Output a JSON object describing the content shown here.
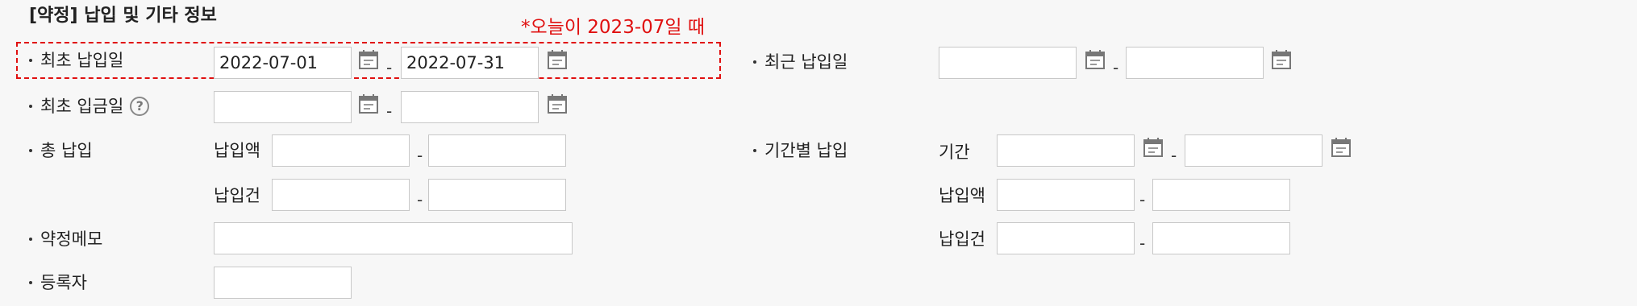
{
  "section": {
    "title": "[약정] 납입 및 기타 정보",
    "note": "*오늘이 2023-07일 때"
  },
  "rows": {
    "first_payment_date": {
      "label": "최초 납입일",
      "from_value": "2022-07-01",
      "to_value": "2022-07-31",
      "separator": "-"
    },
    "recent_payment_date": {
      "label": "최근 납입일",
      "from_value": "",
      "to_value": "",
      "separator": "-"
    },
    "first_deposit_date": {
      "label": "최초 입금일",
      "help_glyph": "?",
      "from_value": "",
      "to_value": "",
      "separator": "-"
    },
    "total_payment": {
      "label": "총 납입",
      "amount_label": "납입액",
      "count_label": "납입건",
      "separator": "-"
    },
    "period_payment": {
      "label": "기간별 납입",
      "period_label": "기간",
      "amount_label": "납입액",
      "count_label": "납입건",
      "separator": "-"
    },
    "pledge_memo": {
      "label": "약정메모",
      "value": ""
    },
    "registrant": {
      "label": "등록자",
      "value": ""
    }
  },
  "icons": {
    "calendar": "calendar-icon",
    "help": "help-icon",
    "bullet": "bullet-dot"
  },
  "colors": {
    "accent": "#e01010",
    "border": "#c8c8c8",
    "background": "#f7f7f7"
  }
}
